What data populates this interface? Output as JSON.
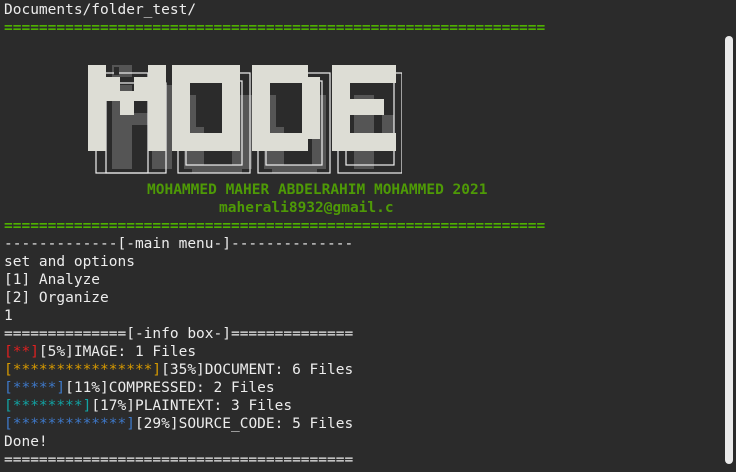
{
  "terminal": {
    "path_line": "Documents/folder_test/",
    "separator_double": "==============================================================",
    "banner": {
      "logo_text": "MODE",
      "author": "MOHAMMED MAHER ABDELRAHIM MOHAMMED 2021",
      "email": "maherali8932@gmail.c"
    },
    "menu_header": "-------------[-main menu-]--------------",
    "prompt": "set and options",
    "options": [
      "[1] Analyze",
      "[2] Organize"
    ],
    "input": "1",
    "info_header": "==============[-info box-]==============",
    "stats": [
      {
        "stars": "[**]",
        "text": "[5%]IMAGE: 1 Files",
        "color": "#e02020"
      },
      {
        "stars": "[****************]",
        "text": "[35%]DOCUMENT: 6 Files",
        "color": "#d79a00"
      },
      {
        "stars": "[*****]",
        "text": "[11%]COMPRESSED: 2 Files",
        "color": "#3e78c8"
      },
      {
        "stars": "[********]",
        "text": "[17%]PLAINTEXT: 3 Files",
        "color": "#12a3a3"
      },
      {
        "stars": "[*************]",
        "text": "[29%]SOURCE_CODE: 5 Files",
        "color": "#3e78c8"
      }
    ],
    "done": "Done!",
    "footer_separator": "========================================"
  }
}
